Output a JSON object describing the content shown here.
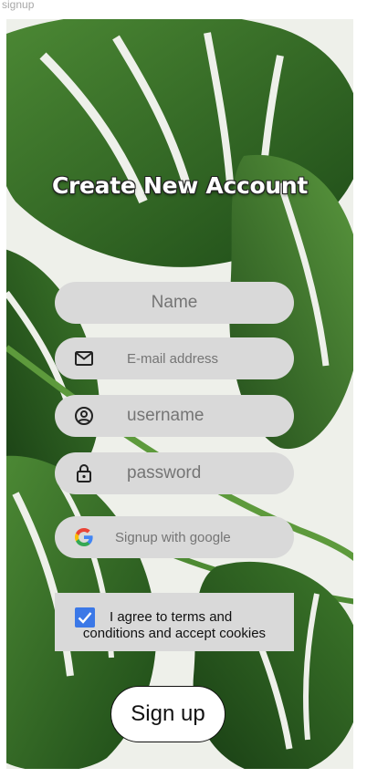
{
  "frame": {
    "label": "signup"
  },
  "title": "Create New Account",
  "form": {
    "name": {
      "placeholder": "Name",
      "icon": "none"
    },
    "email": {
      "placeholder": "E-mail address",
      "icon": "mail-icon"
    },
    "username": {
      "placeholder": "username",
      "icon": "user-circle-icon"
    },
    "password": {
      "placeholder": "password",
      "icon": "lock-icon"
    }
  },
  "google": {
    "label": "Signup with google",
    "icon": "google-icon"
  },
  "terms": {
    "line1": "I agree to terms and",
    "line2": "conditions and accept cookies",
    "checked": true
  },
  "signup": {
    "label": "Sign up"
  },
  "colors": {
    "field_bg": "#d9d9d9",
    "placeholder": "#757575",
    "checkbox": "#3b78e7",
    "leaf_dark": "#1f4d1a",
    "leaf_mid": "#3f7f2c"
  }
}
